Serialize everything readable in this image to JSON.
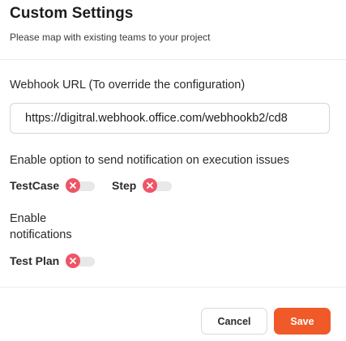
{
  "dialog": {
    "title": "Custom Settings",
    "subtitle": "Please map with existing teams to your project"
  },
  "webhook": {
    "label": "Webhook URL (To override the configuration)",
    "value": "https://digitral.webhook.office.com/webhookb2/cd8"
  },
  "execution_issues": {
    "label": "Enable option to send notification on execution issues",
    "toggles": [
      {
        "label": "TestCase",
        "state": "off",
        "icon": "x-icon"
      },
      {
        "label": "Step",
        "state": "off",
        "icon": "x-icon"
      }
    ]
  },
  "notifications": {
    "label": "Enable notifications",
    "toggles": [
      {
        "label": "Test Plan",
        "state": "off",
        "icon": "x-icon"
      }
    ]
  },
  "footer": {
    "cancel_label": "Cancel",
    "save_label": "Save"
  },
  "colors": {
    "accent": "#f05a28",
    "toggle_off": "#ef5466",
    "track": "#e8e8e8"
  }
}
